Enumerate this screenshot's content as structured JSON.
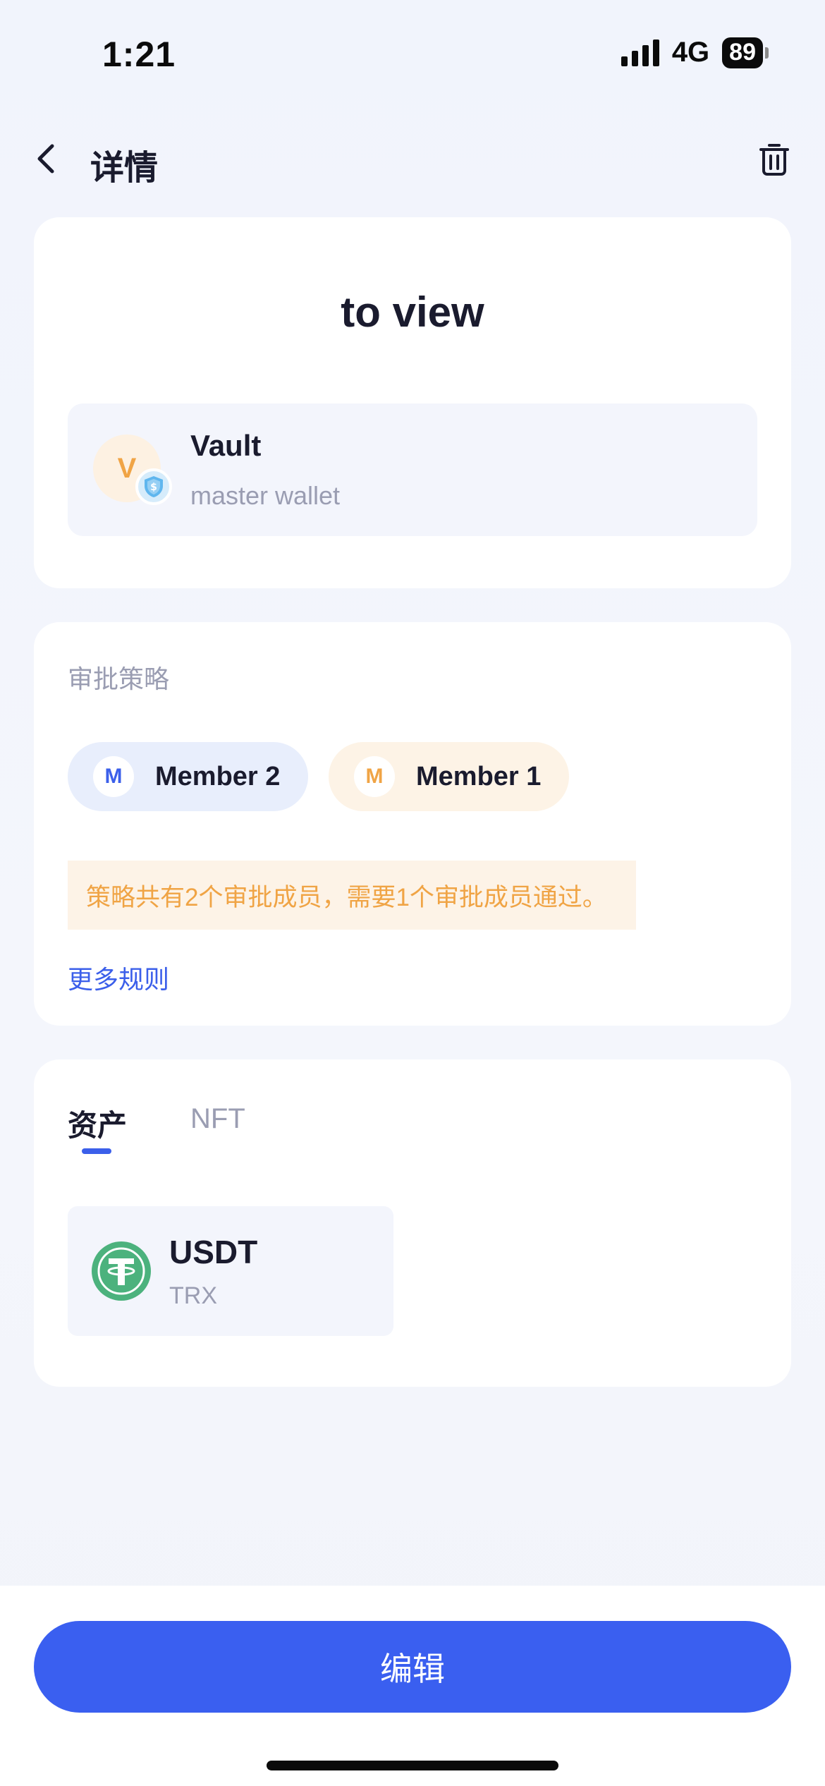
{
  "status_bar": {
    "time": "1:21",
    "network": "4G",
    "battery": "89"
  },
  "header": {
    "title": "详情",
    "back_icon": "chevron-left-icon",
    "trash_icon": "trash-icon"
  },
  "vault": {
    "name": "to view",
    "wallet": {
      "avatar_letter": "V",
      "title": "Vault",
      "subtitle": "master wallet",
      "badge_icon": "shield-dollar-icon"
    }
  },
  "policy": {
    "label": "审批策略",
    "members": [
      {
        "initial": "M",
        "name": "Member 2",
        "color": "#3b5fea"
      },
      {
        "initial": "M",
        "name": "Member 1",
        "color": "#f0a445"
      }
    ],
    "note": "策略共有2个审批成员，需要1个审批成员通过。",
    "more_rules": "更多规则"
  },
  "assets": {
    "tabs": [
      {
        "label": "资产",
        "active": true
      },
      {
        "label": "NFT",
        "active": false
      }
    ],
    "items": [
      {
        "name": "USDT",
        "chain": "TRX",
        "icon": "tether-icon",
        "color": "#4cb27d"
      }
    ]
  },
  "footer": {
    "edit_label": "编辑"
  },
  "colors": {
    "accent": "#3a5ff0",
    "warning": "#f0a445"
  }
}
